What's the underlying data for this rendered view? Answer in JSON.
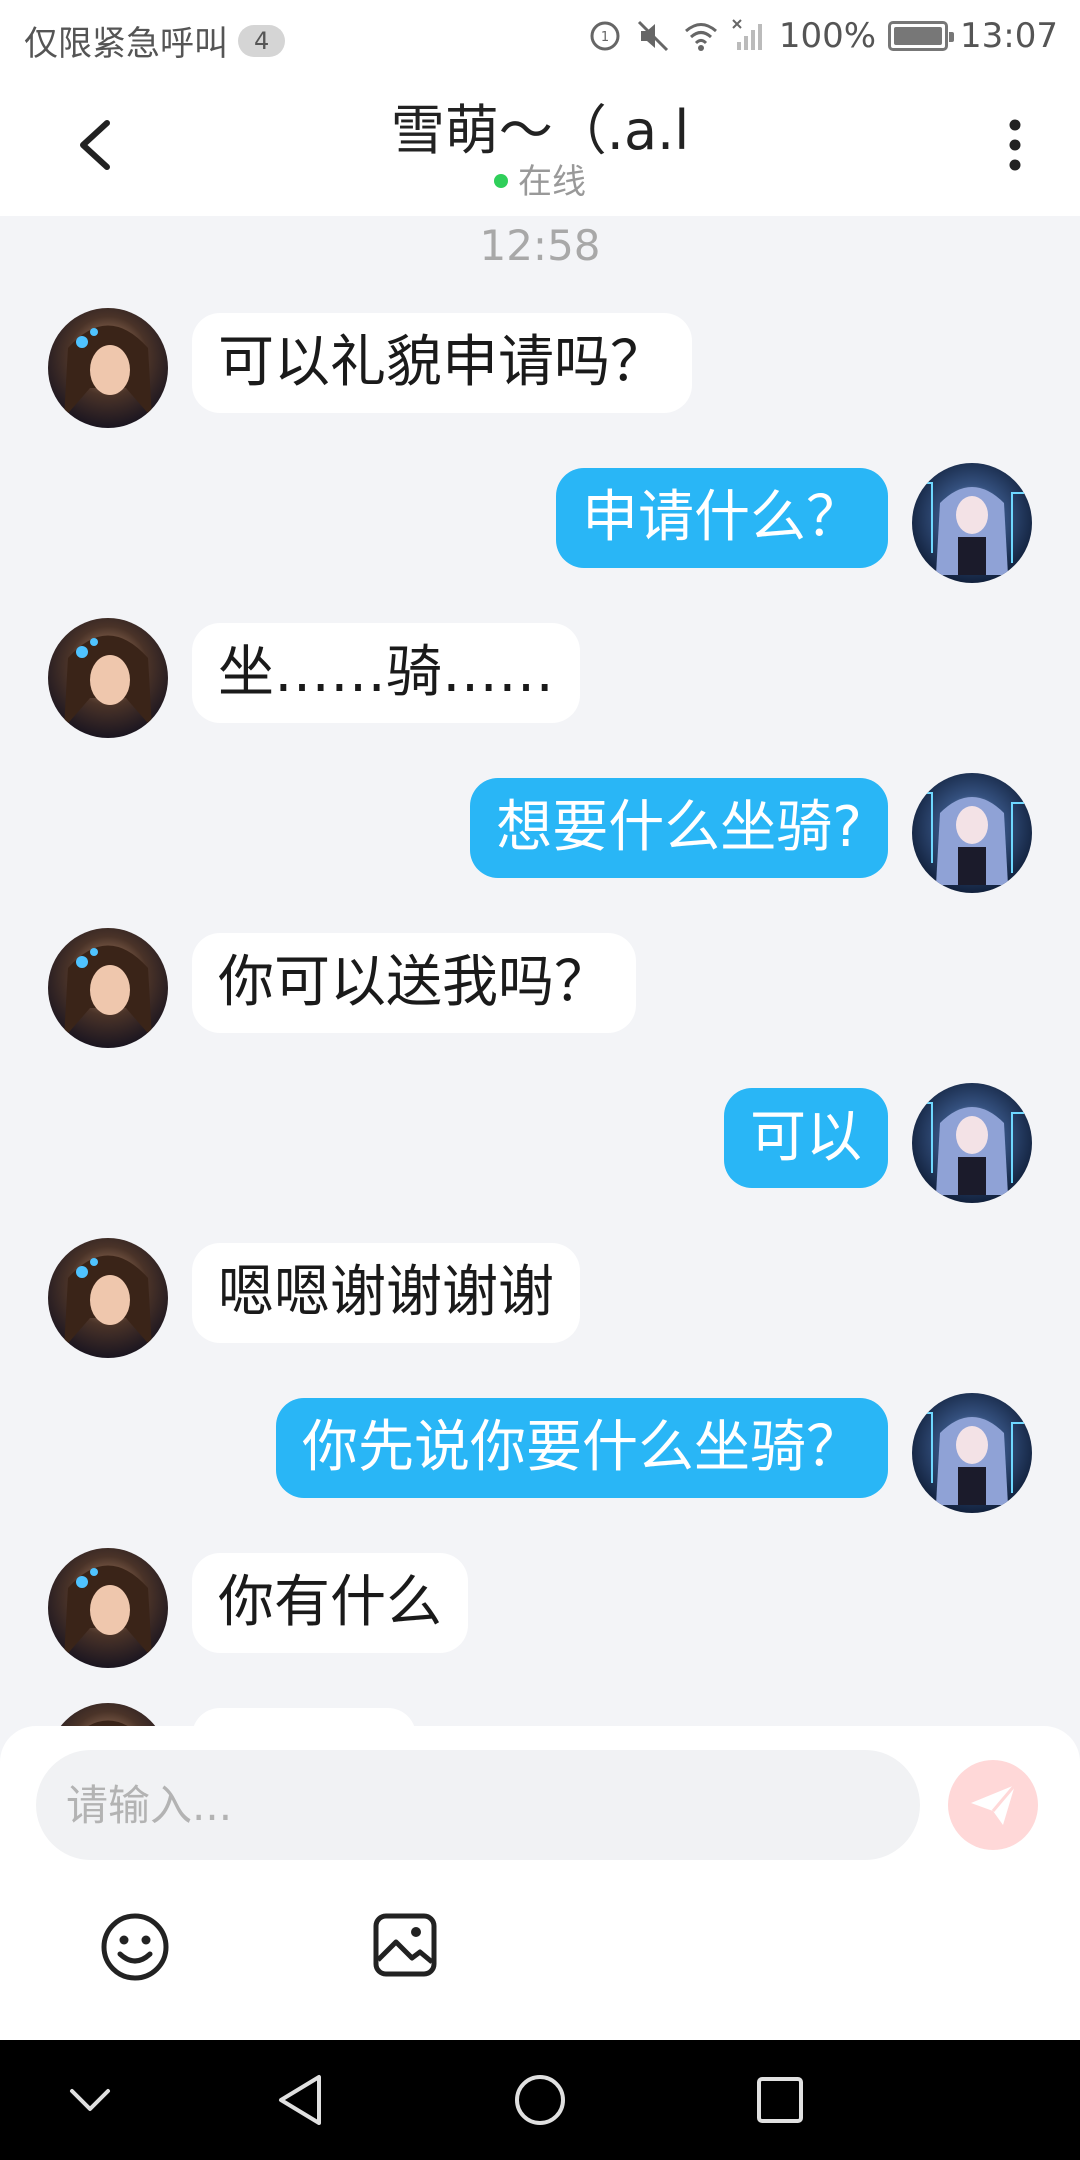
{
  "status_bar": {
    "emergency_text": "仅限紧急呼叫",
    "notification_count": "4",
    "battery_text": "100%",
    "time": "13:07",
    "icons": [
      "data-saver-icon",
      "mute-icon",
      "wifi-icon",
      "no-signal-icon",
      "battery-charging-icon"
    ]
  },
  "header": {
    "back_icon": "chevron-left-icon",
    "title": "雪萌～（.a.l",
    "status": "在线",
    "status_color": "#2fcf5a",
    "more_icon": "vertical-dots-icon"
  },
  "chat": {
    "timestamp": "12:58",
    "colors": {
      "incoming_bubble": "#ffffff",
      "outgoing_bubble": "#29b6f6",
      "background": "#f3f4f7"
    },
    "messages": [
      {
        "direction": "in",
        "text": "可以礼貌申请吗？"
      },
      {
        "direction": "out",
        "text": "申请什么？"
      },
      {
        "direction": "in",
        "text": "坐……骑……"
      },
      {
        "direction": "out",
        "text": "想要什么坐骑?"
      },
      {
        "direction": "in",
        "text": "你可以送我吗？"
      },
      {
        "direction": "out",
        "text": "可以"
      },
      {
        "direction": "in",
        "text": "嗯嗯谢谢谢谢"
      },
      {
        "direction": "out",
        "text": "你先说你要什么坐骑？"
      },
      {
        "direction": "in",
        "text": "你有什么"
      },
      {
        "direction": "in",
        "text": ""
      }
    ]
  },
  "input": {
    "placeholder": "请输入...",
    "value": "",
    "send_icon": "paper-plane-icon",
    "tool_icons": [
      "smiley-icon",
      "image-icon"
    ]
  },
  "nav_bar": {
    "icons": [
      "chevron-down-icon",
      "back-triangle-icon",
      "home-circle-icon",
      "recents-square-icon"
    ]
  }
}
